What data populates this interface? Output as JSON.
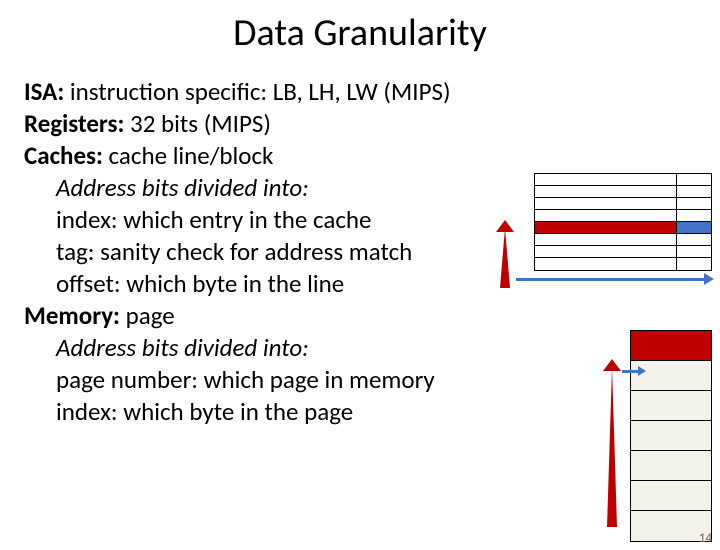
{
  "title": "Data Granularity",
  "lines": {
    "isa_label": "ISA:",
    "isa_text": " instruction specific: LB, LH, LW (MIPS)",
    "reg_label": "Registers:",
    "reg_text": " 32 bits (MIPS)",
    "cache_label": "Caches:",
    "cache_text": " cache line/block",
    "cache_sub": "Address bits divided into:",
    "cache_index": "index: which entry in the cache",
    "cache_tag": "tag: sanity check for address match",
    "cache_offset": "offset: which byte in the line",
    "mem_label": "Memory:",
    "mem_text": " page",
    "mem_sub": "Address bits divided into:",
    "mem_pagenum": "page number: which page in memory",
    "mem_index": "index: which byte in the page"
  },
  "page_number": "14",
  "colors": {
    "red": "#c00000",
    "blue": "#4472c4",
    "cream": "#f2f2ea"
  }
}
